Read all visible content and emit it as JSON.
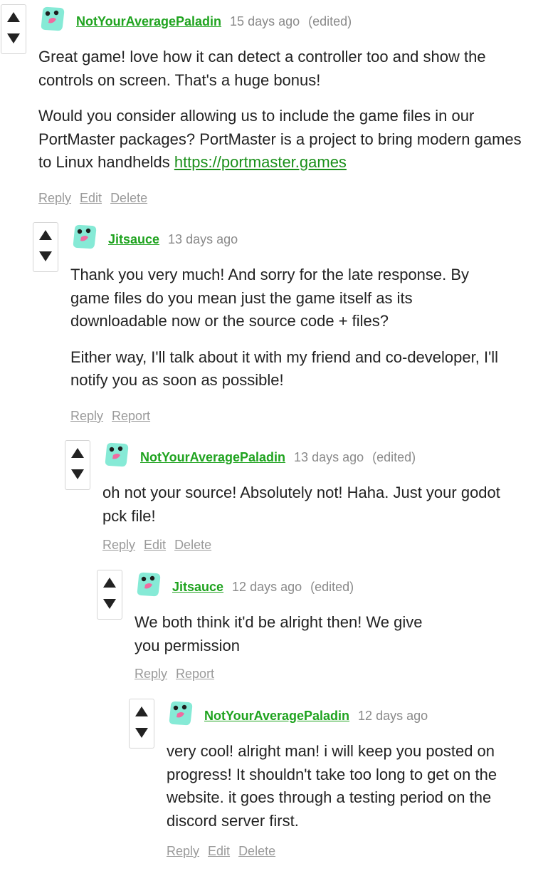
{
  "colors": {
    "author": "#1fa31f",
    "link": "#1a8f1a",
    "meta": "#8a8a8a",
    "action": "#9a9a9a",
    "avatar": "#86ead6",
    "avatar_mouth": "#f06aa0"
  },
  "icons": {
    "upvote": "triangle-up-icon",
    "downvote": "triangle-down-icon",
    "avatar": "blob-avatar-icon"
  },
  "comments": [
    {
      "author": "NotYourAveragePaladin",
      "timestamp": "15 days ago",
      "edited": "(edited)",
      "paragraph1": "Great game! love how it can detect a controller too and show the controls on screen. That's a huge bonus!",
      "paragraph2": "Would you consider allowing us to include the game files in our PortMaster packages? PortMaster is a project to bring modern games to Linux handhelds ",
      "link": "https://portmaster.games",
      "actions": [
        "Reply",
        "Edit",
        "Delete"
      ]
    },
    {
      "author": "Jitsauce",
      "timestamp": "13 days ago",
      "paragraph1": "Thank you very much! And sorry for the late response. By game files do you mean just the game itself as its downloadable now or the source code + files?",
      "paragraph2": "Either way, I'll talk about it with my friend and co-developer, I'll notify you as soon as possible!",
      "actions": [
        "Reply",
        "Report"
      ]
    },
    {
      "author": "NotYourAveragePaladin",
      "timestamp": "13 days ago",
      "edited": "(edited)",
      "paragraph1": "oh not your source! Absolutely not! Haha. Just your godot pck file!",
      "actions": [
        "Reply",
        "Edit",
        "Delete"
      ]
    },
    {
      "author": "Jitsauce",
      "timestamp": "12 days ago",
      "edited": "(edited)",
      "paragraph1": "We both think it'd be alright then! We give you permission",
      "actions": [
        "Reply",
        "Report"
      ]
    },
    {
      "author": "NotYourAveragePaladin",
      "timestamp": "12 days ago",
      "paragraph1": "very cool! alright man! i will keep you posted on progress! It shouldn't take too long to get on the website. it goes through a testing period on the discord server first.",
      "actions": [
        "Reply",
        "Edit",
        "Delete"
      ]
    }
  ]
}
